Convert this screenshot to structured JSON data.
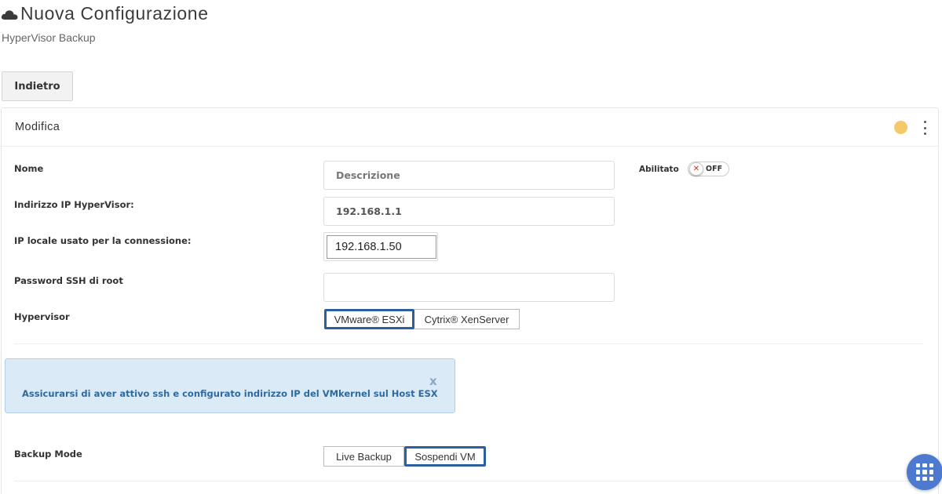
{
  "header": {
    "title": "Nuova Configurazione",
    "subtitle": "HyperVisor Backup",
    "icon": "cloud-icon"
  },
  "toolbar": {
    "back_label": "Indietro"
  },
  "panel": {
    "title": "Modifica",
    "status_color": "#f4c96a"
  },
  "form": {
    "nome": {
      "label": "Nome",
      "placeholder": "Descrizione",
      "value": ""
    },
    "ip_hypervisor": {
      "label": "Indirizzo IP HyperVisor:",
      "value": "192.168.1.1"
    },
    "ip_locale": {
      "label": "IP locale usato per la connessione:",
      "value": "192.168.1.50"
    },
    "password": {
      "label": "Password SSH di root",
      "value": ""
    },
    "hypervisor": {
      "label": "Hypervisor",
      "options": [
        "VMware® ESXi",
        "Cytrix® XenServer"
      ],
      "selected": "VMware® ESXi"
    },
    "abilitato": {
      "label": "Abilitato",
      "state": "OFF",
      "off_icon": "x-icon"
    },
    "backup_mode": {
      "label": "Backup Mode",
      "options": [
        "Live Backup",
        "Sospendi VM"
      ],
      "selected": "Sospendi VM"
    }
  },
  "alert": {
    "text": "Assicurarsi di aver attivo ssh e configurato indirizzo IP del VMkernel sul Host ESX",
    "close_label": "x"
  },
  "fab": {
    "icon": "apps-grid-icon",
    "color": "#4d7ad0"
  },
  "colors": {
    "selected_border": "#2c5f9e",
    "alert_bg": "#dbeaf7",
    "alert_text": "#2e6a9e"
  }
}
